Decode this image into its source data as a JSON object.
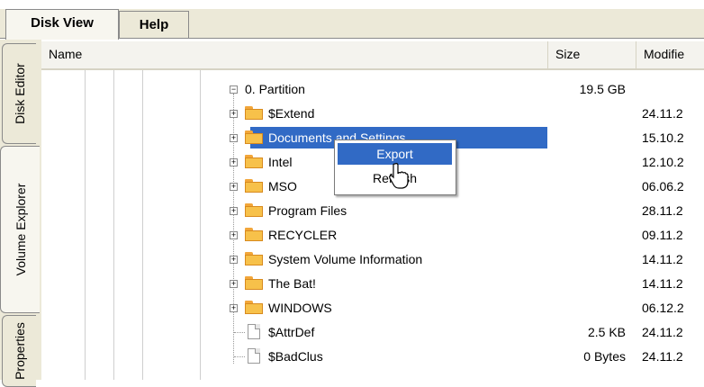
{
  "tabs": [
    {
      "label": "Disk View",
      "active": true
    },
    {
      "label": "Help",
      "active": false
    }
  ],
  "side_tabs": [
    {
      "label": "Disk Editor",
      "active": false
    },
    {
      "label": "Volume Explorer",
      "active": true
    },
    {
      "label": "Properties",
      "active": false
    }
  ],
  "columns": {
    "name": "Name",
    "size": "Size",
    "modified": "Modifie"
  },
  "partition": {
    "label": "0. Partition",
    "size": "19.5 GB",
    "icon": "minus-expander-icon"
  },
  "rows": [
    {
      "name": "$Extend",
      "size": "",
      "modified": "24.11.2",
      "type": "folder"
    },
    {
      "name": "Documents and Settings",
      "size": "",
      "modified": "15.10.2",
      "type": "folder",
      "selected": true
    },
    {
      "name": "Intel",
      "size": "",
      "modified": "12.10.2",
      "type": "folder"
    },
    {
      "name": "MSO",
      "size": "",
      "modified": "06.06.2",
      "type": "folder"
    },
    {
      "name": "Program Files",
      "size": "",
      "modified": "28.11.2",
      "type": "folder"
    },
    {
      "name": "RECYCLER",
      "size": "",
      "modified": "09.11.2",
      "type": "folder"
    },
    {
      "name": "System Volume Information",
      "size": "",
      "modified": "14.11.2",
      "type": "folder"
    },
    {
      "name": "The Bat!",
      "size": "",
      "modified": "14.11.2",
      "type": "folder"
    },
    {
      "name": "WINDOWS",
      "size": "",
      "modified": "06.12.2",
      "type": "folder"
    },
    {
      "name": "$AttrDef",
      "size": "2.5 KB",
      "modified": "24.11.2",
      "type": "file"
    },
    {
      "name": "$BadClus",
      "size": "0 Bytes",
      "modified": "24.11.2",
      "type": "file"
    }
  ],
  "context_menu": {
    "export": "Export",
    "refresh": "Refresh"
  },
  "colors": {
    "selection": "#316ac5",
    "folder": "#f7c14a",
    "chrome": "#ece9d8"
  }
}
